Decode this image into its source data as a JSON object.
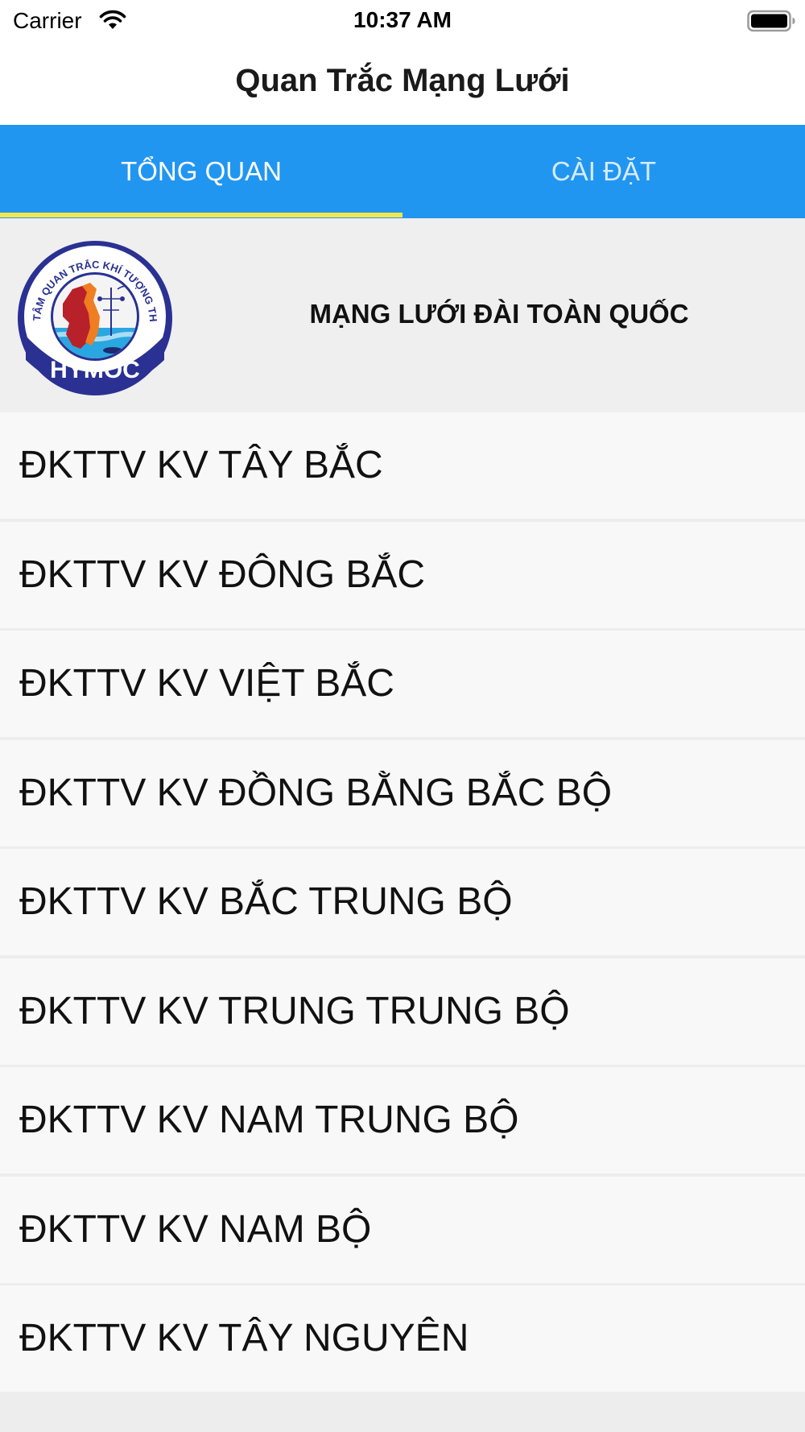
{
  "status_bar": {
    "carrier": "Carrier",
    "time": "10:37 AM",
    "icons": [
      "wifi-icon",
      "battery-icon"
    ]
  },
  "nav": {
    "title": "Quan Trắc Mạng Lưới"
  },
  "tabs": [
    {
      "label": "TỔNG QUAN",
      "selected": true
    },
    {
      "label": "CÀI ĐẶT",
      "selected": false
    }
  ],
  "banner": {
    "logo_icon": "hymoc-logo",
    "logo_text_top": "TRUNG TÂM QUAN TRẮC KHÍ TƯỢNG THỦY VĂN",
    "logo_text_bottom": "HYMOC",
    "title": "MẠNG LƯỚI ĐÀI TOÀN QUỐC"
  },
  "stations": [
    "ĐKTTV KV TÂY BẮC",
    "ĐKTTV KV ĐÔNG BẮC",
    "ĐKTTV KV VIỆT BẮC",
    "ĐKTTV KV ĐỒNG BẰNG BẮC BỘ",
    "ĐKTTV KV BẮC TRUNG BỘ",
    "ĐKTTV KV TRUNG TRUNG BỘ",
    "ĐKTTV KV NAM TRUNG BỘ",
    "ĐKTTV KV NAM BỘ",
    "ĐKTTV KV TÂY NGUYÊN"
  ],
  "colors": {
    "tab_bar": "#2196f0",
    "tab_indicator": "#f2e64a",
    "logo_ring": "#2a3192",
    "logo_red": "#b8202a",
    "logo_orange": "#ef7d22",
    "logo_water": "#2aa7e0"
  }
}
